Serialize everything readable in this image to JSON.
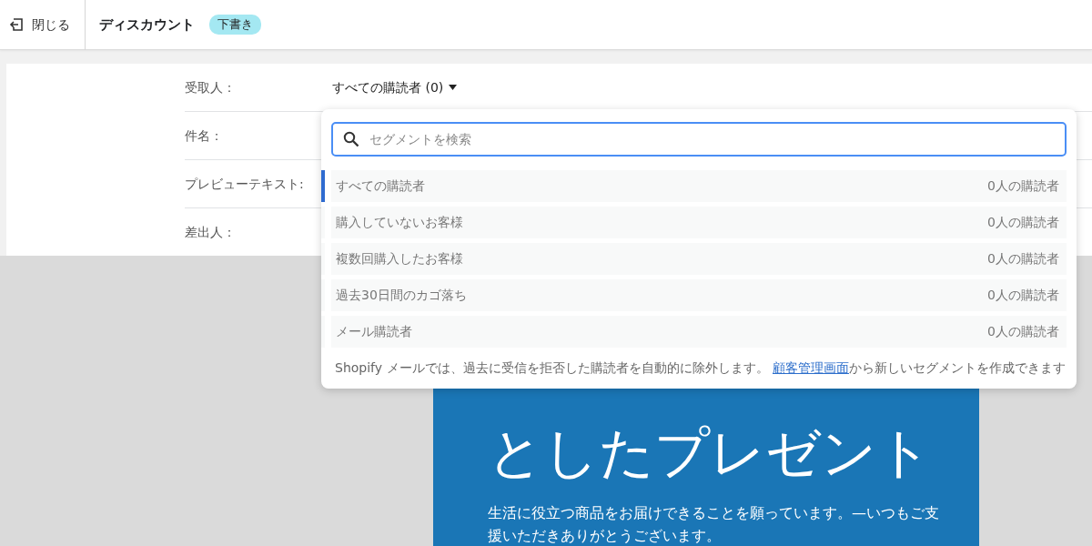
{
  "topbar": {
    "close_label": "閉じる",
    "title": "ディスカウント",
    "status_badge": "下書き"
  },
  "fields": [
    {
      "label": "受取人："
    },
    {
      "label": "件名："
    },
    {
      "label": "プレビューテキスト:"
    },
    {
      "label": "差出人："
    }
  ],
  "recipient_select": {
    "value": "すべての購読者 (0)"
  },
  "dropdown": {
    "search": {
      "placeholder": "セグメントを検索"
    },
    "segments": [
      {
        "name": "すべての購読者",
        "count": "0人の購読者",
        "selected": true
      },
      {
        "name": "購入していないお客様",
        "count": "0人の購読者",
        "selected": false
      },
      {
        "name": "複数回購入したお客様",
        "count": "0人の購読者",
        "selected": false
      },
      {
        "name": "過去30日間のカゴ落ち",
        "count": "0人の購読者",
        "selected": false
      },
      {
        "name": "メール購読者",
        "count": "0人の購読者",
        "selected": false
      }
    ],
    "footer": {
      "before": "Shopify メールでは、過去に受信を拒否した購読者を自動的に除外します。 ",
      "link": "顧客管理画面",
      "after": "から新しいセグメントを作成できます"
    }
  },
  "preview": {
    "heading": "としたプレゼント",
    "body": "生活に役立つ商品をお届けできることを願っています。—いつもご支援いただきありがとうございます。"
  }
}
